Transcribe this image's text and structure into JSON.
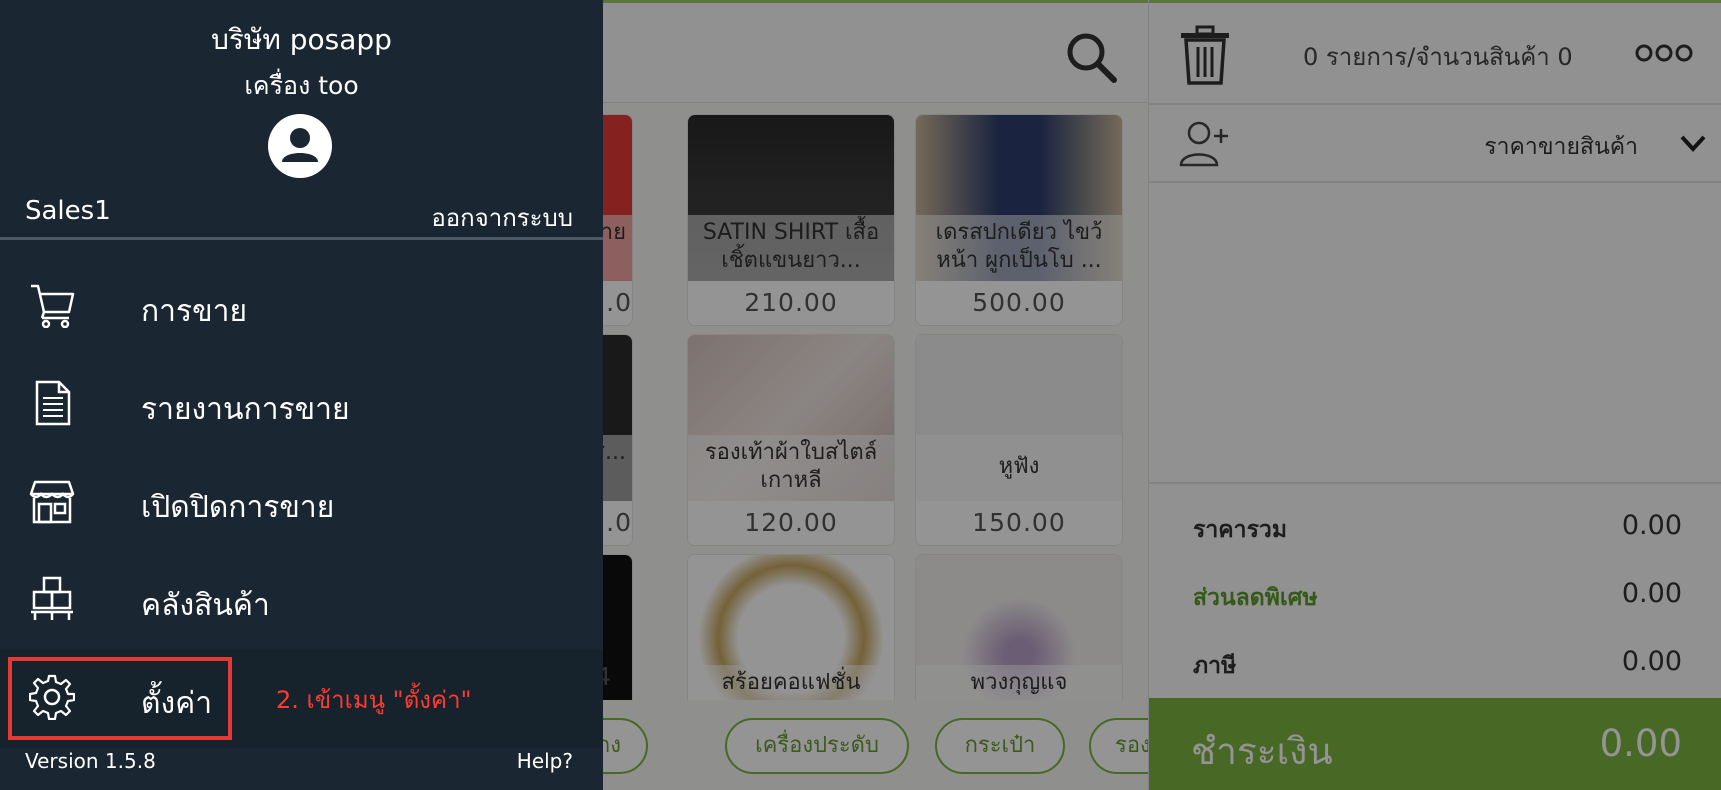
{
  "drawer": {
    "company": "บริษัท posapp",
    "device": "เครื่อง too",
    "user": "Sales1",
    "logout": "ออกจากระบบ",
    "menu": [
      {
        "label": "การขาย",
        "icon": "cart-icon"
      },
      {
        "label": "รายงานการขาย",
        "icon": "report-icon"
      },
      {
        "label": "เปิดปิดการขาย",
        "icon": "store-icon"
      },
      {
        "label": "คลังสินค้า",
        "icon": "warehouse-icon"
      },
      {
        "label": "ตั้งค่า",
        "icon": "gear-icon"
      }
    ],
    "annotation": "2. เข้าเมนู \"ตั้งค่า\"",
    "version": "Version 1.5.8",
    "help": "Help?"
  },
  "products": [
    {
      "name": "...สาย",
      "price": "...0"
    },
    {
      "name": "SATIN SHIRT เสื้อเชิ้ตแขนยาว...",
      "price": "210.00"
    },
    {
      "name": "เดรสปกเดียว ไขว้หน้า ผูกเป็นโบ ...",
      "price": "500.00"
    },
    {
      "name": "...ตล์ ...าส...",
      "price": "...0"
    },
    {
      "name": "รองเท้าผ้าใบสไตล์ เกาหลี",
      "price": "120.00"
    },
    {
      "name": "หูฟัง",
      "price": "150.00"
    },
    {
      "name": "",
      "price": "...64"
    },
    {
      "name": "สร้อยคอแฟชั่น",
      "price": ""
    },
    {
      "name": "พวงกุญแจ",
      "price": ""
    }
  ],
  "categories": [
    "...กางเกง",
    "เครื่องประดับ",
    "กระเป๋า",
    "รอง..."
  ],
  "cart": {
    "count_text": "0 รายการ/จำนวนสินค้า 0",
    "price_selector": "ราคาขายสินค้า",
    "totals": [
      {
        "label": "ราคารวม",
        "value": "0.00"
      },
      {
        "label": "ส่วนลดพิเศษ",
        "value": "0.00"
      },
      {
        "label": "ภาษี",
        "value": "0.00"
      }
    ],
    "pay_label": "ชำระเงิน",
    "pay_value": "0.00"
  },
  "colors": {
    "drawer_bg": "#1a2632",
    "accent_green": "#7cb342",
    "annotation_red": "#e53935"
  }
}
